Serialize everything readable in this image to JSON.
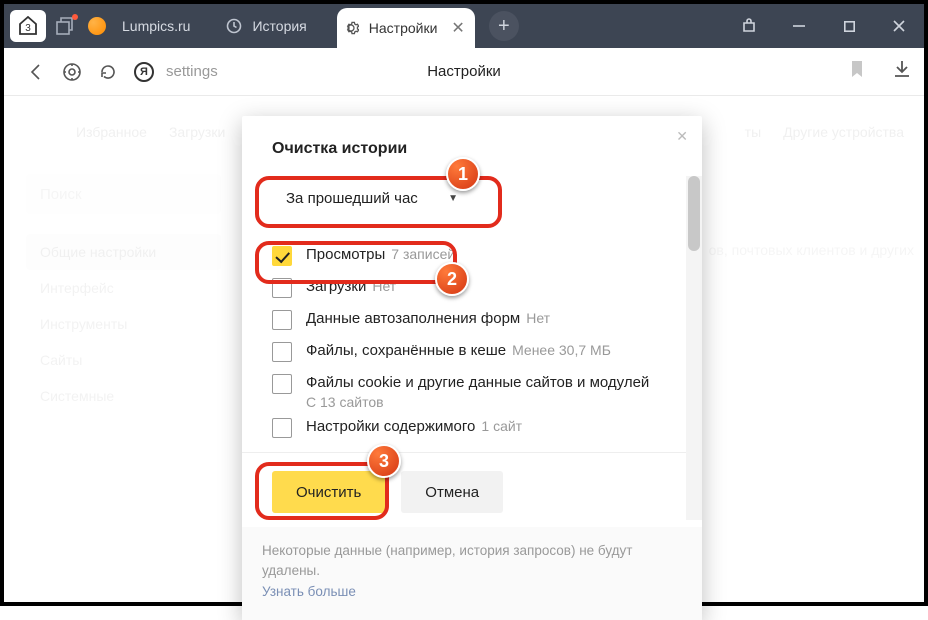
{
  "titlebar": {
    "tab_count": "3",
    "tabs": [
      {
        "label": "Lumpics.ru"
      },
      {
        "label": "История"
      },
      {
        "label": "Настройки"
      }
    ]
  },
  "addressbar": {
    "logo_letter": "Я",
    "url_text": "settings",
    "page_title": "Настройки"
  },
  "ghost": {
    "nav": [
      "Избранное",
      "Загрузки"
    ],
    "nav_right": [
      "ты",
      "Другие устройства"
    ],
    "search_placeholder": "Поиск",
    "sidebar": [
      "Общие настройки",
      "Интерфейс",
      "Инструменты",
      "Сайты",
      "Системные"
    ],
    "far_text": "ов, почтовых клиентов и других"
  },
  "dialog": {
    "title": "Очистка истории",
    "dropdown": "За прошедший час",
    "items": [
      {
        "checked": true,
        "label": "Просмотры",
        "sub": "7 записей"
      },
      {
        "checked": false,
        "label": "Загрузки",
        "sub": "Нет"
      },
      {
        "checked": false,
        "label": "Данные автозаполнения форм",
        "sub": "Нет"
      },
      {
        "checked": false,
        "label": "Файлы, сохранённые в кеше",
        "sub": "Менее 30,7 МБ"
      },
      {
        "checked": false,
        "label": "Файлы cookie и другие данные сайтов и модулей",
        "sub_block": "С 13 сайтов"
      },
      {
        "checked": false,
        "label": "Настройки содержимого",
        "sub": "1 сайт"
      }
    ],
    "primary_btn": "Очистить",
    "secondary_btn": "Отмена",
    "footer_text": "Некоторые данные (например, история запросов) не будут удалены.",
    "footer_link": "Узнать больше"
  },
  "annotations": [
    "1",
    "2",
    "3"
  ]
}
